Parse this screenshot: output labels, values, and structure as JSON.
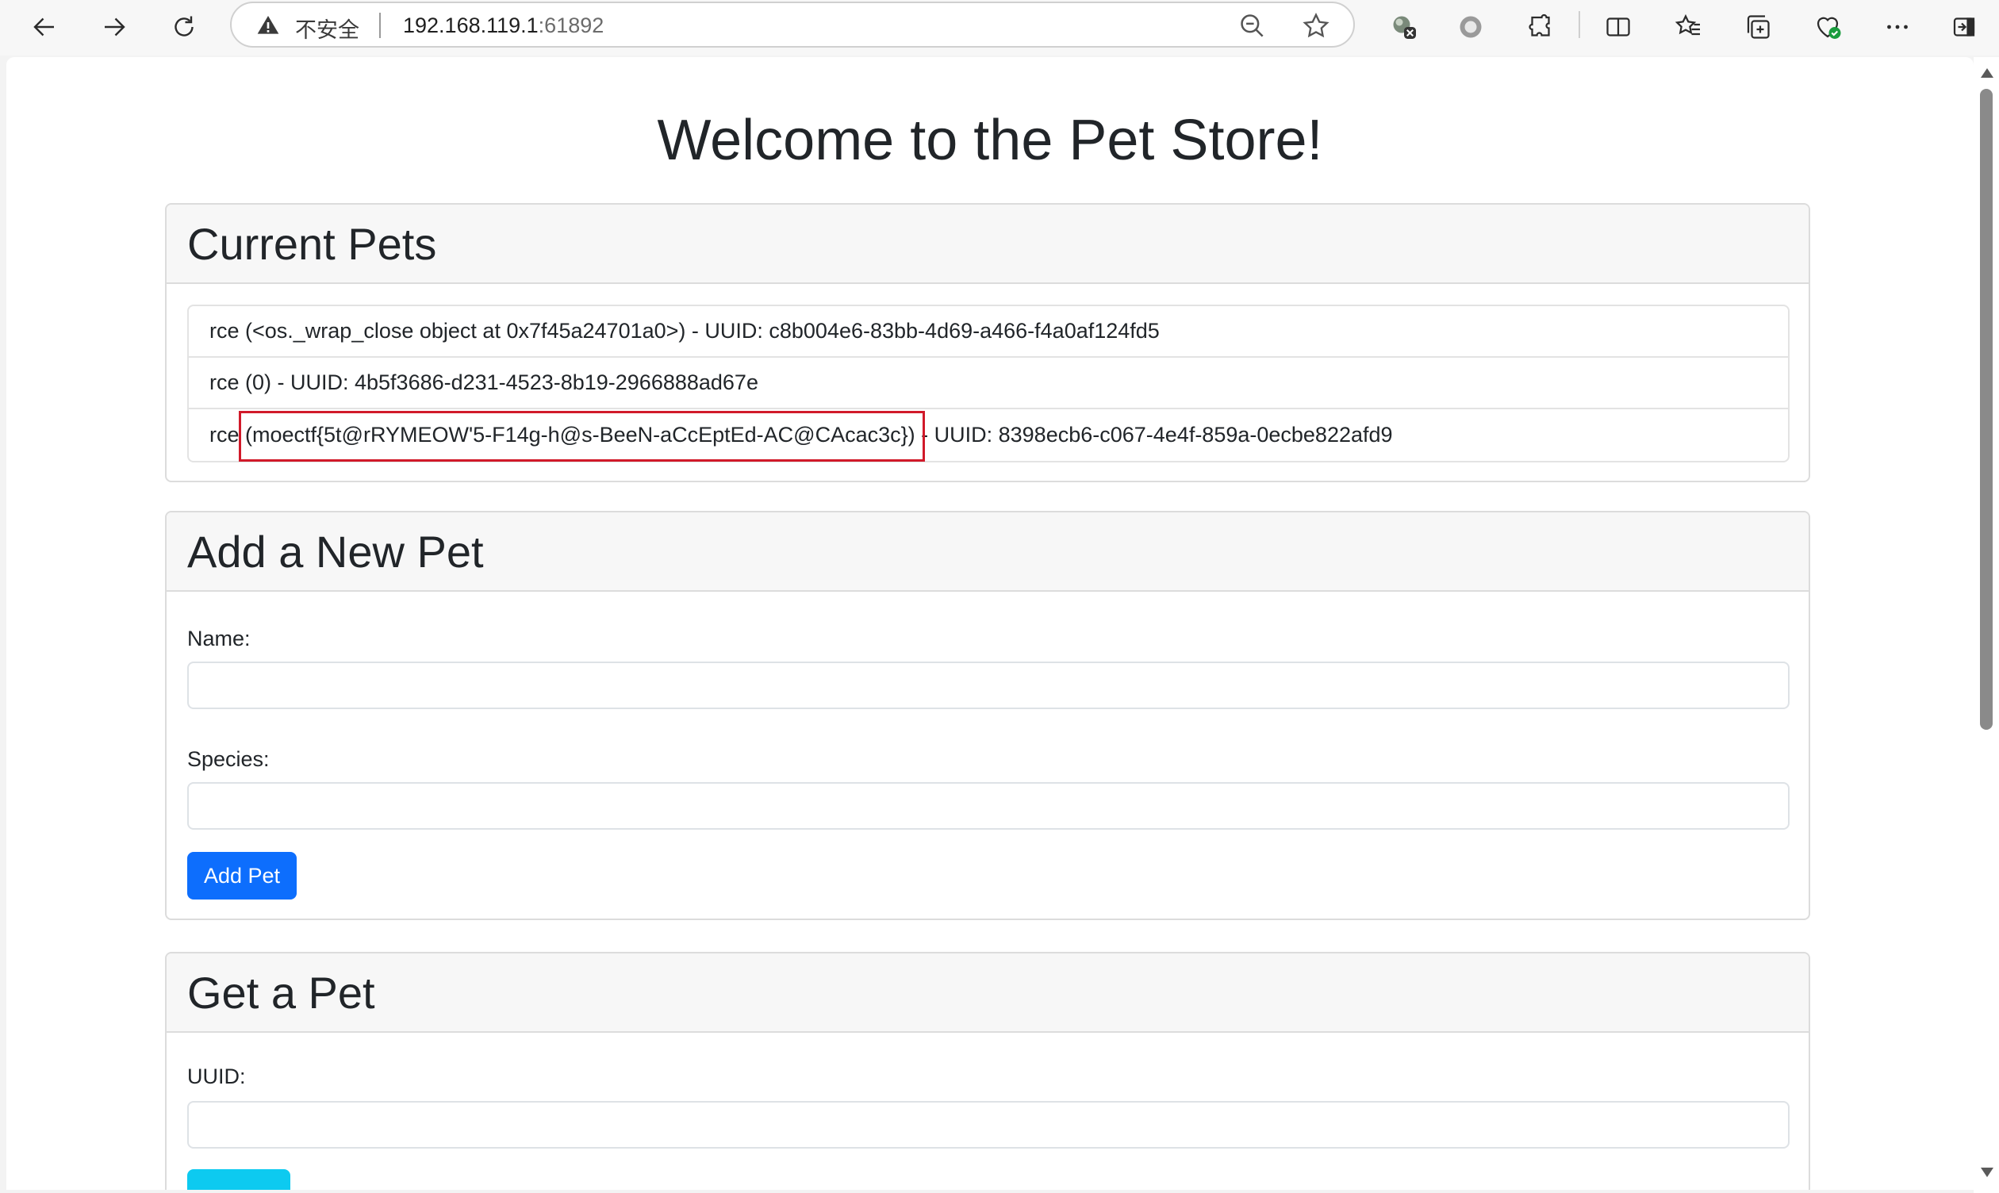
{
  "browser": {
    "security_label": "不安全",
    "url_host": "192.168.119.1",
    "url_port": ":61892",
    "icons": [
      "back-icon",
      "forward-icon",
      "refresh-icon",
      "warning-icon",
      "zoom-out-icon",
      "favorite-star-icon",
      "extension-icon",
      "circle-extension-icon",
      "puzzle-icon",
      "split-screen-icon",
      "favorites-list-icon",
      "collections-icon",
      "browser-essentials-icon",
      "more-icon",
      "sidebar-icon"
    ]
  },
  "page": {
    "title": "Welcome to the Pet Store!"
  },
  "current_pets": {
    "heading": "Current Pets",
    "items": [
      {
        "text": "rce (<os._wrap_close object at 0x7f45a24701a0>) - UUID: c8b004e6-83bb-4d69-a466-f4a0af124fd5"
      },
      {
        "text": "rce (0) - UUID: 4b5f3686-d231-4523-8b19-2966888ad67e"
      },
      {
        "text": "rce (moectf{5t@rRYMEOW'5-F14g-h@s-BeeN-aCcEptEd-AC@CAcac3c}) - UUID: 8398ecb6-c067-4e4f-859a-0ecbe822afd9"
      }
    ]
  },
  "add_pet": {
    "heading": "Add a New Pet",
    "name_label": "Name:",
    "name_value": "",
    "species_label": "Species:",
    "species_value": "",
    "button_label": "Add Pet"
  },
  "get_pet": {
    "heading": "Get a Pet",
    "uuid_label": "UUID:",
    "uuid_value": ""
  },
  "colors": {
    "primary_button": "#0d6efd",
    "info_button": "#0dcaf0",
    "highlight": "#d11a2a"
  }
}
